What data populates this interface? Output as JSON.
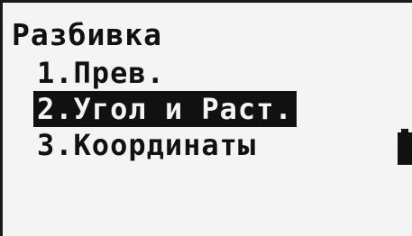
{
  "screen": {
    "title": "Разбивка",
    "menu": [
      {
        "label": "1.Прев.",
        "selected": false
      },
      {
        "label": "2.Угол и Раст.",
        "selected": true
      },
      {
        "label": "3.Координаты",
        "selected": false
      }
    ],
    "battery_icon": "battery-icon"
  }
}
